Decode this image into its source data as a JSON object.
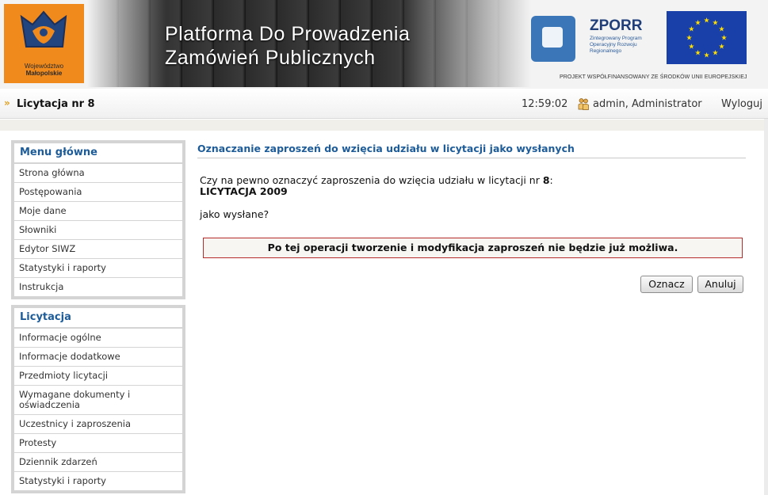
{
  "banner": {
    "title_line1": "Platforma Do Prowadzenia",
    "title_line2": "Zamówień Publicznych",
    "region_logo_line1": "Województwo",
    "region_logo_line2": "Małopolskie",
    "zporr_name": "ZPORR",
    "zporr_sub": "Zintegrowany Program Operacyjny Rozwoju Regionalnego",
    "project_note": "PROJEKT WSPÓŁFINANSOWANY ZE ŚRODKÓW UNII EUROPEJSKIEJ"
  },
  "topbar": {
    "breadcrumb": "Licytacja nr 8",
    "clock": "12:59:02",
    "user": "admin, Administrator",
    "logout": "Wyloguj"
  },
  "sidebar": {
    "main_menu": {
      "title": "Menu główne",
      "items": [
        "Strona główna",
        "Postępowania",
        "Moje dane",
        "Słowniki",
        "Edytor SIWZ",
        "Statystyki i raporty",
        "Instrukcja"
      ]
    },
    "auction_menu": {
      "title": "Licytacja",
      "items": [
        "Informacje ogólne",
        "Informacje dodatkowe",
        "Przedmioty licytacji",
        "Wymagane dokumenty i oświadczenia",
        "Uczestnicy i zaproszenia",
        "Protesty",
        "Dziennik zdarzeń",
        "Statystyki i raporty"
      ]
    }
  },
  "main": {
    "title": "Oznaczanie zaproszeń do wzięcia udziału w licytacji jako wysłanych",
    "question_prefix": "Czy na pewno oznaczyć zaproszenia do wzięcia udziału w licytacji nr ",
    "auction_number": "8",
    "question_suffix": ":",
    "auction_name": "LICYTACJA 2009",
    "as_sent": "jako wysłane?",
    "warning": "Po tej operacji tworzenie i modyfikacja zaproszeń nie będzie już możliwa.",
    "mark_button": "Oznacz",
    "cancel_button": "Anuluj"
  },
  "colors": {
    "accent_blue": "#1d5c99",
    "warning_border": "#b52a2a",
    "logo_orange": "#f08a1c",
    "eu_blue": "#1840a8",
    "eu_star": "#ffdd00"
  },
  "icons": {
    "breadcrumb": "double-chevron-right-icon",
    "user": "users-icon"
  }
}
